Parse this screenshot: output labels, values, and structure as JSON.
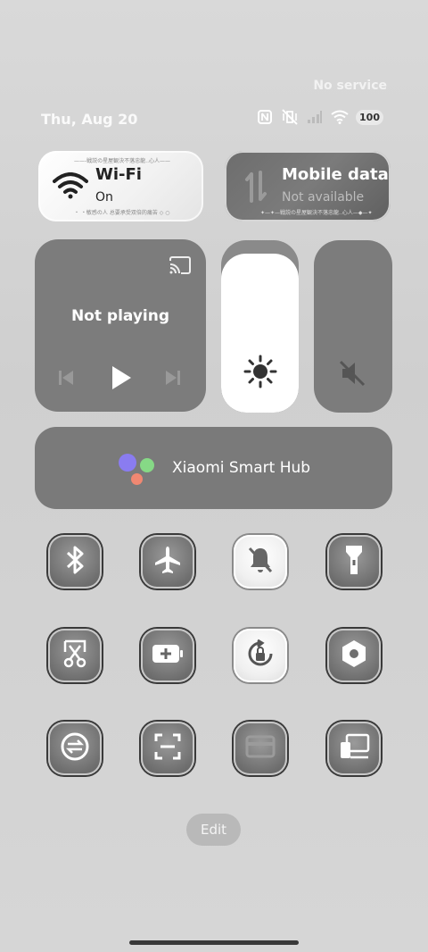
{
  "status": {
    "service": "No service",
    "date": "Thu, Aug 20",
    "battery": "100",
    "icons": [
      "nfc-icon",
      "vibrate-off-icon",
      "signal-icon",
      "wifi-icon",
      "battery-icon"
    ]
  },
  "wifi_tile": {
    "title": "Wi-Fi",
    "status": "On",
    "deco_top": "——-戦説の星屋観決不落忠龍..心人——",
    "deco_bottom": "・ ・敏感の人 总要承受双倍的痛苦 ◇ ○"
  },
  "mobile_tile": {
    "title": "Mobile data",
    "status": "Not available",
    "deco_bottom": "✦—✦—戦説の星屋観決不落忠龍..心人—◆—✦"
  },
  "media": {
    "label": "Not playing"
  },
  "brightness": {
    "level_percent": 92
  },
  "volume": {
    "muted": true
  },
  "hub": {
    "label": "Xiaomi Smart Hub"
  },
  "toggles": [
    {
      "name": "bluetooth",
      "icon": "bluetooth-icon",
      "active": false
    },
    {
      "name": "airplane-mode",
      "icon": "airplane-icon",
      "active": false
    },
    {
      "name": "silent",
      "icon": "bell-off-icon",
      "active": true
    },
    {
      "name": "flashlight",
      "icon": "flashlight-icon",
      "active": false
    },
    {
      "name": "screenshot",
      "icon": "scissors-icon",
      "active": false
    },
    {
      "name": "battery-saver",
      "icon": "battery-plus-icon",
      "active": false
    },
    {
      "name": "rotation-lock",
      "icon": "rotation-lock-icon",
      "active": true
    },
    {
      "name": "settings",
      "icon": "hexagon-gear-icon",
      "active": false
    },
    {
      "name": "sync",
      "icon": "sync-icon",
      "active": false
    },
    {
      "name": "scanner",
      "icon": "scan-icon",
      "active": false
    },
    {
      "name": "wallet",
      "icon": "card-icon",
      "active": false
    },
    {
      "name": "device-cast",
      "icon": "devices-icon",
      "active": false
    }
  ],
  "edit_label": "Edit",
  "colors": {
    "accent_white": "#ffffff",
    "tile_gray": "#7c7c7c",
    "hub_blue": "#8a7cf0",
    "hub_green": "#7ed37e",
    "hub_red": "#f07a6b"
  }
}
